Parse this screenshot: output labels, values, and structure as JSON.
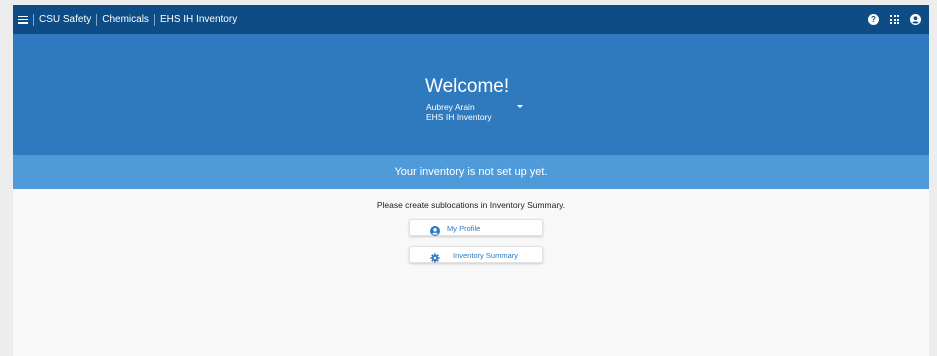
{
  "header": {
    "crumbs": [
      "CSU Safety",
      "Chemicals",
      "EHS IH Inventory"
    ],
    "icons": [
      "menu-icon",
      "help-icon",
      "apps-grid-icon",
      "account-icon"
    ]
  },
  "hero": {
    "title": "Welcome!",
    "user_name": "Aubrey Arain",
    "app_name": "EHS IH Inventory"
  },
  "notice": {
    "text": "Your inventory is not set up yet."
  },
  "main": {
    "hint": "Please create sublocations in Inventory Summary.",
    "buttons": [
      {
        "label": "My Profile",
        "icon": "account-icon"
      },
      {
        "label": "Inventory Summary",
        "icon": "gear-icon"
      }
    ]
  },
  "colors": {
    "topbar": "#0e4c86",
    "hero": "#2f7abf",
    "notice": "#4f9bd9",
    "accent": "#2f7abf"
  }
}
